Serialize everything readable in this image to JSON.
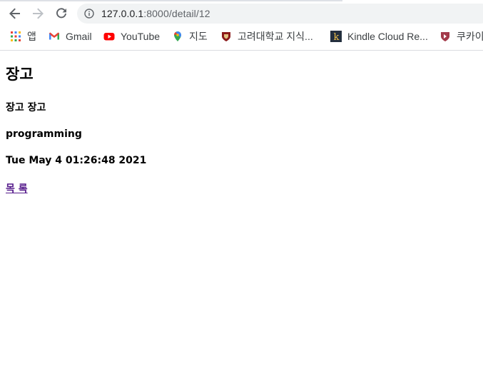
{
  "browser": {
    "url_host": "127.0.0.1",
    "url_rest": ":8000/detail/12",
    "bookmarks": [
      {
        "label": "앱",
        "icon": "apps-grid-icon"
      },
      {
        "label": "Gmail",
        "icon": "gmail-icon"
      },
      {
        "label": "YouTube",
        "icon": "youtube-icon"
      },
      {
        "label": "지도",
        "icon": "maps-pin-icon"
      },
      {
        "label": "고려대학교 지식...",
        "icon": "korea-univ-icon"
      },
      {
        "label": "Kindle Cloud Re...",
        "icon": "kindle-icon"
      },
      {
        "label": "쿠카이",
        "icon": "kuka-icon"
      }
    ]
  },
  "page": {
    "title": "장고",
    "subtitle": "장고 장고",
    "category": "programming",
    "timestamp": "Tue May 4 01:26:48 2021",
    "list_link": "목 록"
  },
  "colors": {
    "link_visited": "#551a8b",
    "omnibox_bg": "#f1f3f4",
    "youtube_red": "#ff0000",
    "kindle_bg": "#232f3e"
  }
}
